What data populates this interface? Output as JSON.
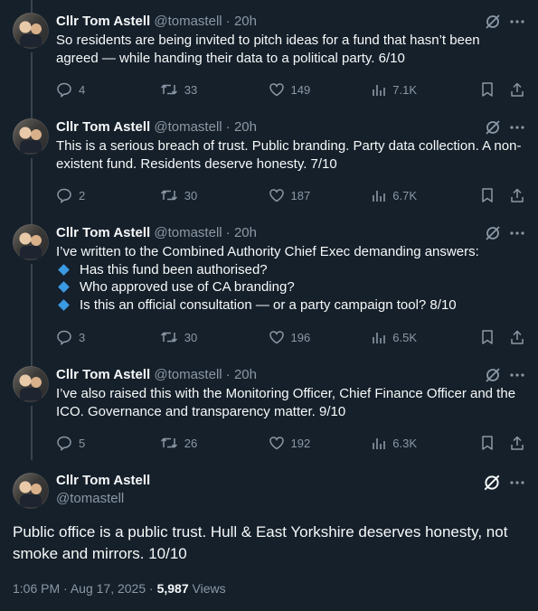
{
  "author": {
    "name": "Cllr Tom Astell",
    "handle": "@tomastell"
  },
  "separator": "·",
  "tweets": [
    {
      "time": "20h",
      "text": "So residents are being invited to pitch ideas for a fund that hasn’t been agreed — while handing their data to a political party. 6/10",
      "replies": "4",
      "retweets": "33",
      "likes": "149",
      "views": "7.1K"
    },
    {
      "time": "20h",
      "text": "This is a serious breach of trust. Public branding. Party data collection. A non-existent fund. Residents deserve honesty. 7/10",
      "replies": "2",
      "retweets": "30",
      "likes": "187",
      "views": "6.7K"
    },
    {
      "time": "20h",
      "text": "I’ve written to the Combined Authority Chief Exec demanding answers:",
      "bullets": [
        "Has this fund been authorised?",
        "Who approved use of CA branding?",
        "Is this an official consultation — or a party campaign tool? 8/10"
      ],
      "replies": "3",
      "retweets": "30",
      "likes": "196",
      "views": "6.5K"
    },
    {
      "time": "20h",
      "text": "I’ve also raised  this with the Monitoring Officer, Chief Finance Officer and the ICO. Governance and transparency matter. 9/10",
      "replies": "5",
      "retweets": "26",
      "likes": "192",
      "views": "6.3K"
    }
  ],
  "main": {
    "text": "Public office is a public trust. Hull & East Yorkshire deserves honesty, not smoke and mirrors. 10/10",
    "time": "1:06 PM",
    "date": "Aug 17, 2025",
    "views_count": "5,987",
    "views_label": "Views"
  },
  "colors": {
    "background": "#15202b",
    "text": "#f7f9f9",
    "muted": "#8b98a5",
    "bullet": "#3b9ae1",
    "thread_line": "#38444d"
  },
  "icons": [
    "grok-icon",
    "more-icon",
    "reply-icon",
    "retweet-icon",
    "like-icon",
    "views-icon",
    "bookmark-icon",
    "share-icon",
    "diamond-bullet-icon"
  ]
}
